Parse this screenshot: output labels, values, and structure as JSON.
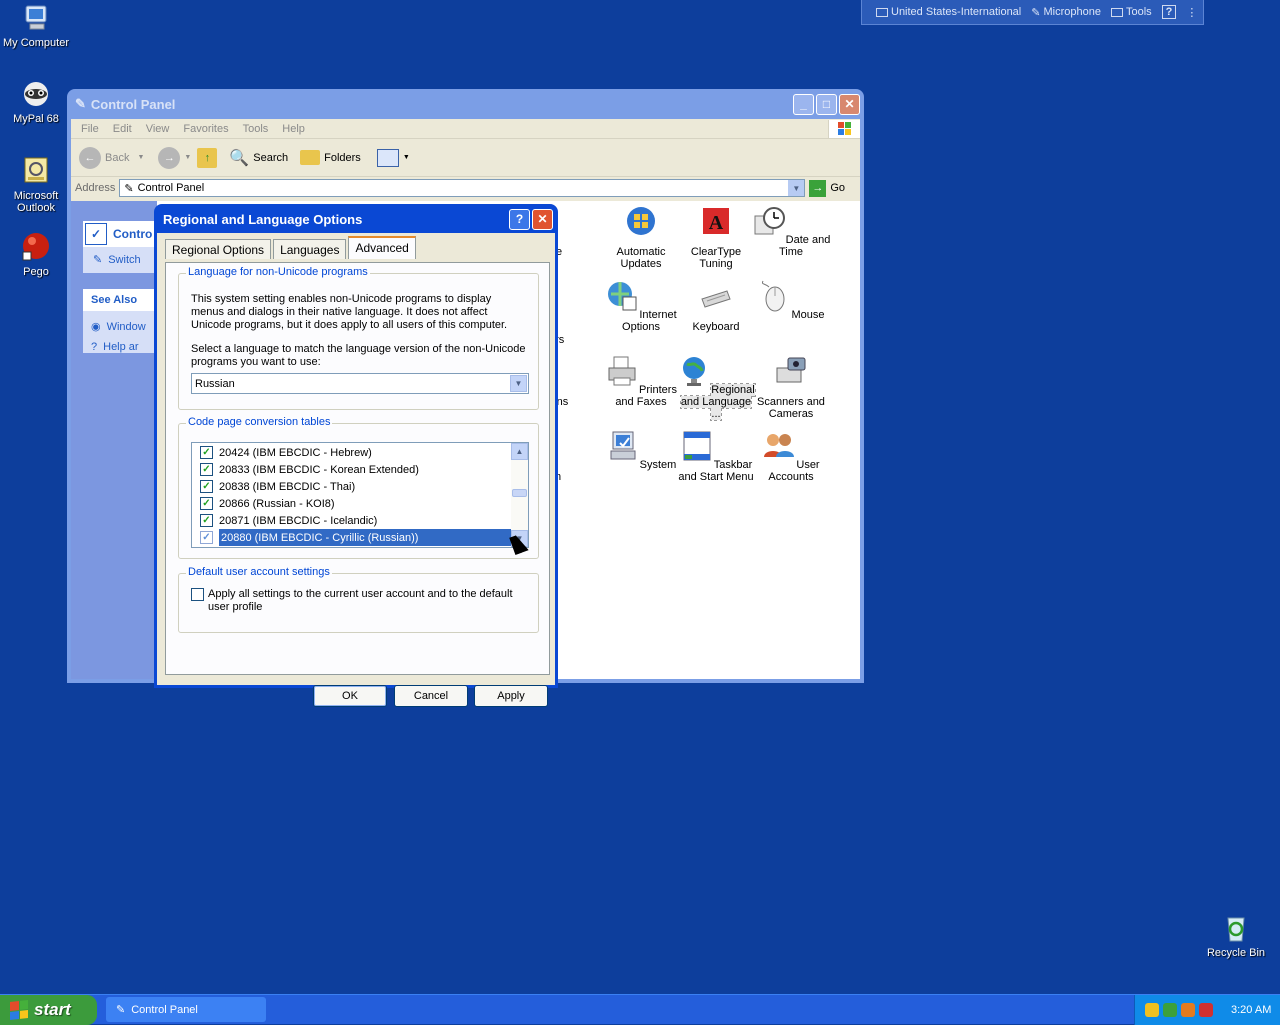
{
  "desktop": {
    "icons": [
      {
        "label": "My Computer",
        "icon": "my-computer-icon"
      },
      {
        "label": "MyPal 68",
        "icon": "raccoon-browser-icon"
      },
      {
        "label": "Microsoft Outlook",
        "icon": "outlook-icon"
      },
      {
        "label": "Pego",
        "icon": "red-ball-icon"
      },
      {
        "label": "Recycle Bin",
        "icon": "recycle-bin-icon"
      }
    ]
  },
  "langbar": {
    "language": "United States-International",
    "microphone": "Microphone",
    "tools": "Tools",
    "help": "?"
  },
  "control_panel": {
    "title": "Control Panel",
    "menu": [
      "File",
      "Edit",
      "View",
      "Favorites",
      "Tools",
      "Help"
    ],
    "toolbar": {
      "back": "Back",
      "search": "Search",
      "folders": "Folders"
    },
    "address_label": "Address",
    "address_value": "Control Panel",
    "go_label": "Go",
    "left_panel": {
      "header": "Contro",
      "switch": "Switch",
      "see_also": "See Also",
      "see_also_items": [
        "Window",
        "Help ar"
      ]
    },
    "partial_labels": [
      "tive",
      "ers",
      "tions",
      "n"
    ],
    "items": [
      {
        "label": "Automatic Updates",
        "icon": "automatic-updates-icon"
      },
      {
        "label": "ClearType Tuning",
        "icon": "cleartype-icon"
      },
      {
        "label": "Date and Time",
        "icon": "date-time-icon"
      },
      {
        "label": "Internet Options",
        "icon": "internet-options-icon"
      },
      {
        "label": "Keyboard",
        "icon": "keyboard-icon"
      },
      {
        "label": "Mouse",
        "icon": "mouse-icon"
      },
      {
        "label": "Printers and Faxes",
        "icon": "printer-icon"
      },
      {
        "label": "Regional and Language ...",
        "icon": "globe-icon"
      },
      {
        "label": "Scanners and Cameras",
        "icon": "scanner-icon"
      },
      {
        "label": "System",
        "icon": "system-icon"
      },
      {
        "label": "Taskbar and Start Menu",
        "icon": "taskbar-icon"
      },
      {
        "label": "User Accounts",
        "icon": "user-accounts-icon"
      }
    ]
  },
  "dialog": {
    "title": "Regional and Language Options",
    "tabs": [
      "Regional Options",
      "Languages",
      "Advanced"
    ],
    "active_tab": "Advanced",
    "nonunicode": {
      "legend": "Language for non-Unicode programs",
      "description": "This system setting enables non-Unicode programs to display menus and dialogs in their native language. It does not affect Unicode programs, but it does apply to all users of this computer.",
      "prompt": "Select a language to match the language version of the non-Unicode programs you want to use:",
      "selected": "Russian"
    },
    "codepages": {
      "legend": "Code page conversion tables",
      "rows": [
        {
          "label": "20424 (IBM EBCDIC - Hebrew)",
          "checked": true
        },
        {
          "label": "20833 (IBM EBCDIC - Korean Extended)",
          "checked": true
        },
        {
          "label": "20838 (IBM EBCDIC - Thai)",
          "checked": true
        },
        {
          "label": "20866 (Russian - KOI8)",
          "checked": true
        },
        {
          "label": "20871 (IBM EBCDIC - Icelandic)",
          "checked": true
        },
        {
          "label": "20880 (IBM EBCDIC - Cyrillic (Russian))",
          "checked": true,
          "selected": true
        }
      ]
    },
    "default_account": {
      "legend": "Default user account settings",
      "checkbox_label": "Apply all settings to the current user account and to the default user profile",
      "checked": false
    },
    "buttons": {
      "ok": "OK",
      "cancel": "Cancel",
      "apply": "Apply"
    }
  },
  "taskbar": {
    "start": "start",
    "task": "Control Panel",
    "clock": "3:20 AM"
  },
  "colors": {
    "desktop": "#0d3e9c",
    "titlebar_active": "#0a48d4",
    "selection": "#316ac5",
    "start_green": "#3c9b3c"
  }
}
